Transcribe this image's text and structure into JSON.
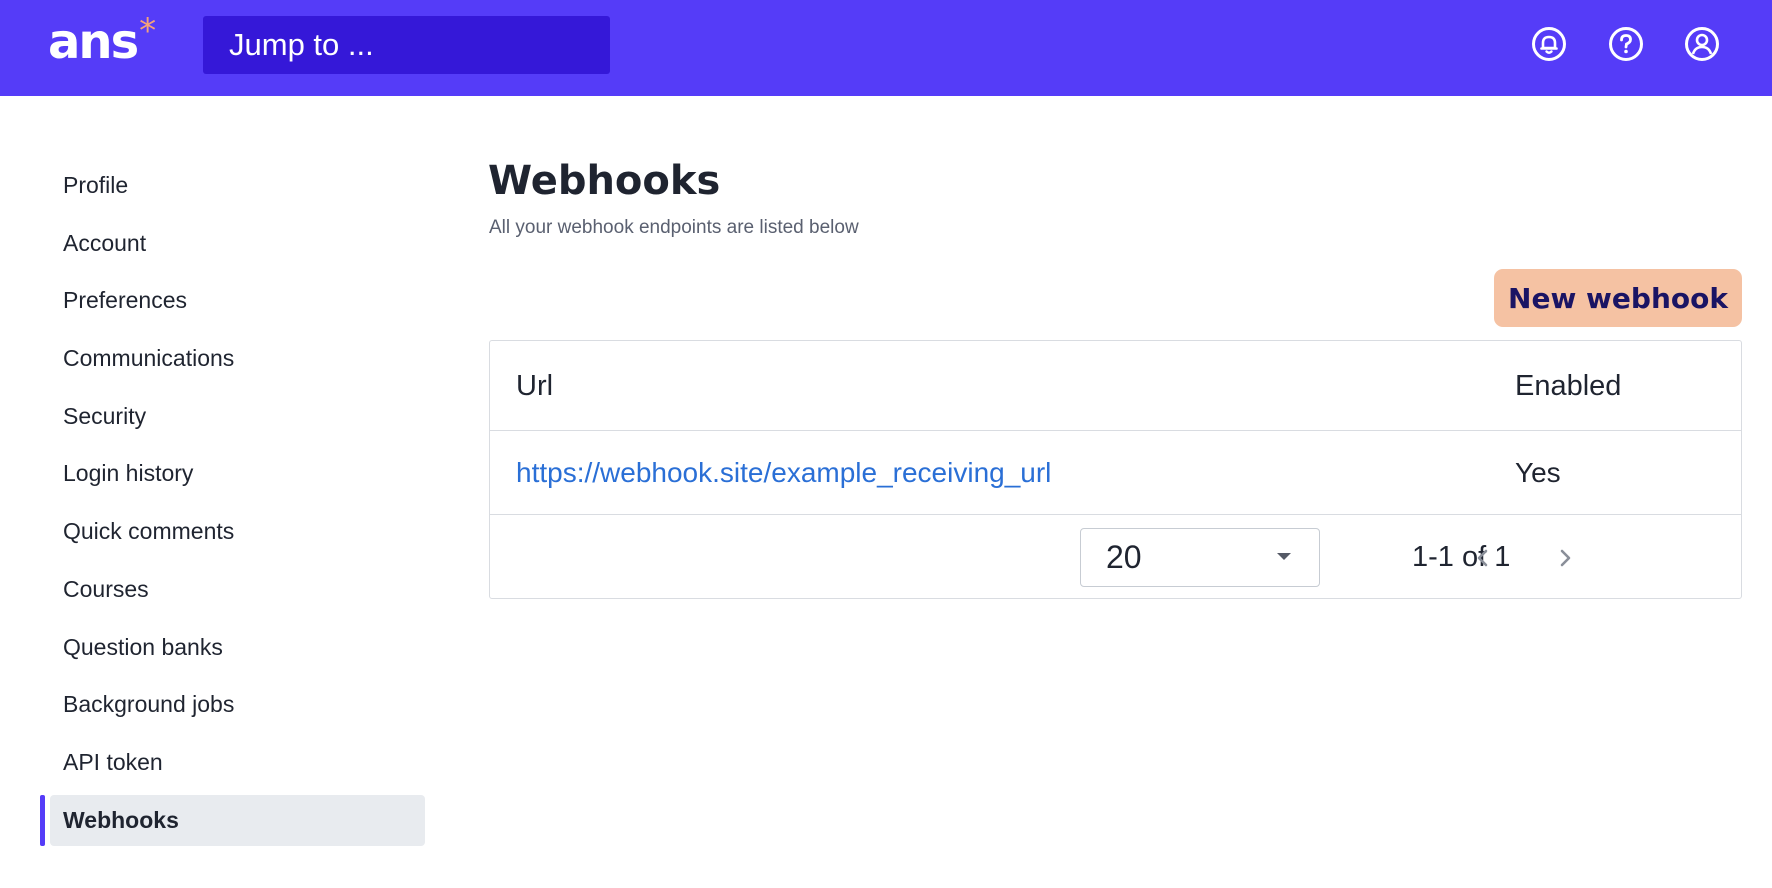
{
  "header": {
    "logo_text": "ans",
    "logo_mark": "*",
    "search_placeholder": "Jump to ...",
    "icons": [
      "notifications-bell-icon",
      "help-question-icon",
      "user-account-icon"
    ]
  },
  "sidebar": {
    "items": [
      {
        "label": "Profile"
      },
      {
        "label": "Account"
      },
      {
        "label": "Preferences"
      },
      {
        "label": "Communications"
      },
      {
        "label": "Security"
      },
      {
        "label": "Login history"
      },
      {
        "label": "Quick comments"
      },
      {
        "label": "Courses"
      },
      {
        "label": "Question banks"
      },
      {
        "label": "Background jobs"
      },
      {
        "label": "API token"
      },
      {
        "label": "Webhooks",
        "active": true
      }
    ]
  },
  "main": {
    "title": "Webhooks",
    "subtitle": "All your webhook endpoints are listed below",
    "new_button_label": "New webhook",
    "table": {
      "columns": [
        "Url",
        "Enabled"
      ],
      "rows": [
        {
          "url": "https://webhook.site/example_receiving_url",
          "enabled": "Yes"
        }
      ]
    },
    "pagination": {
      "per_page": "20",
      "range": "1-1 of 1"
    }
  },
  "colors": {
    "brand": "#553cf8",
    "search_bg": "#3518d8",
    "accent_button": "#f5c2a3",
    "link": "#2a6fd6",
    "active_item_bg": "#e8ebef"
  }
}
